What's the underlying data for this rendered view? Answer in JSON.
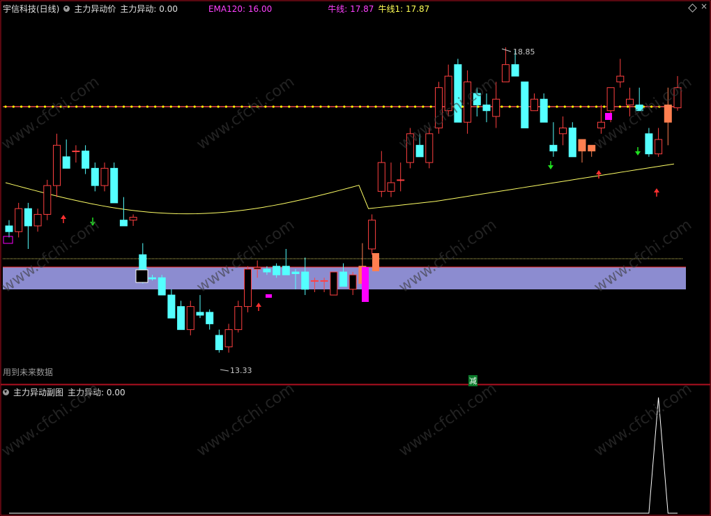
{
  "main_header": {
    "stock": "宇信科技(日线)",
    "indicator": "主力异动价",
    "value_label": "主力异动: 0.00",
    "ema_label": "EMA120: 16.00",
    "niu_label": "牛线: 17.87",
    "niu1_label": "牛线1: 17.87"
  },
  "sub_header": {
    "indicator": "主力异动副图",
    "value_label": "主力异动: 0.00"
  },
  "annotations": {
    "high": "18.85",
    "low": "13.33",
    "future_data": "用到未来数据",
    "jian": "减"
  },
  "watermark": "www.cfchi.com",
  "colors": {
    "up": "#ff4040",
    "down": "#54ffff",
    "ema": "#ffff66",
    "niu": "#ffff00",
    "band": "#8c8cd0",
    "magenta": "#ff00ff",
    "orange": "#ff7f50",
    "border": "#b01020"
  },
  "chart_data": {
    "type": "candlestick",
    "ohlc": [
      [
        15.8,
        15.9,
        15.6,
        15.7
      ],
      [
        15.7,
        16.2,
        15.6,
        16.1
      ],
      [
        16.1,
        16.2,
        15.4,
        15.8
      ],
      [
        15.8,
        16.1,
        15.7,
        16.0
      ],
      [
        16.0,
        16.6,
        15.9,
        16.5
      ],
      [
        16.5,
        17.4,
        16.3,
        17.2
      ],
      [
        17.0,
        17.3,
        16.8,
        16.8
      ],
      [
        17.1,
        17.2,
        16.9,
        17.1
      ],
      [
        17.1,
        17.2,
        16.7,
        16.8
      ],
      [
        16.8,
        16.9,
        16.4,
        16.5
      ],
      [
        16.5,
        16.9,
        16.4,
        16.8
      ],
      [
        16.8,
        16.9,
        16.2,
        16.2
      ],
      [
        15.9,
        16.3,
        15.8,
        15.8
      ],
      [
        15.9,
        16.0,
        15.8,
        15.95
      ],
      [
        15.3,
        15.5,
        14.8,
        14.9
      ],
      [
        14.9,
        14.95,
        14.85,
        14.88
      ],
      [
        14.9,
        14.95,
        14.6,
        14.6
      ],
      [
        14.6,
        14.7,
        14.2,
        14.2
      ],
      [
        14.4,
        14.5,
        14.0,
        14.0
      ],
      [
        14.0,
        14.5,
        13.9,
        14.4
      ],
      [
        14.3,
        14.6,
        14.2,
        14.25
      ],
      [
        14.3,
        14.35,
        14.0,
        14.1
      ],
      [
        13.9,
        14.0,
        13.6,
        13.65
      ],
      [
        13.7,
        14.1,
        13.6,
        14.0
      ],
      [
        14.0,
        14.5,
        13.95,
        14.4
      ],
      [
        14.4,
        15.1,
        14.3,
        15.05
      ],
      [
        15.05,
        15.2,
        14.9,
        15.08
      ],
      [
        15.05,
        15.1,
        14.95,
        15.0
      ],
      [
        15.1,
        15.15,
        14.9,
        14.95
      ],
      [
        15.1,
        15.4,
        14.95,
        14.95
      ],
      [
        15.0,
        15.05,
        14.7,
        14.97
      ],
      [
        15.0,
        15.25,
        14.6,
        14.7
      ],
      [
        14.85,
        14.9,
        14.65,
        14.85
      ],
      [
        14.85,
        14.9,
        14.65,
        14.85
      ],
      [
        14.6,
        15.0,
        14.6,
        15.0
      ],
      [
        15.0,
        15.15,
        14.8,
        14.75
      ],
      [
        14.7,
        15.0,
        14.6,
        14.95
      ],
      [
        15.1,
        15.5,
        14.9,
        14.8
      ],
      [
        15.4,
        16.0,
        15.3,
        15.9
      ],
      [
        16.4,
        17.1,
        16.3,
        16.9
      ],
      [
        16.4,
        16.9,
        16.3,
        16.55
      ],
      [
        16.6,
        16.9,
        16.4,
        16.6
      ],
      [
        16.9,
        17.5,
        16.8,
        17.4
      ],
      [
        17.2,
        17.4,
        17.0,
        17.0
      ],
      [
        16.9,
        17.5,
        16.8,
        17.4
      ],
      [
        17.5,
        18.3,
        17.4,
        18.2
      ],
      [
        17.8,
        18.6,
        17.7,
        18.4
      ],
      [
        18.6,
        18.7,
        17.6,
        17.6
      ],
      [
        17.6,
        18.5,
        17.4,
        18.3
      ],
      [
        18.1,
        18.2,
        17.7,
        17.9
      ],
      [
        17.9,
        18.1,
        17.6,
        17.8
      ],
      [
        17.7,
        18.3,
        17.5,
        18.0
      ],
      [
        18.3,
        18.9,
        18.3,
        18.6
      ],
      [
        18.6,
        18.85,
        18.4,
        18.4
      ],
      [
        18.3,
        18.3,
        17.5,
        17.5
      ],
      [
        17.8,
        18.1,
        17.8,
        18.0
      ],
      [
        18.0,
        18.1,
        17.6,
        17.6
      ],
      [
        17.2,
        17.6,
        17.0,
        17.1
      ],
      [
        17.4,
        17.7,
        17.2,
        17.5
      ],
      [
        17.5,
        17.6,
        17.0,
        17.0
      ],
      [
        17.1,
        17.2,
        16.9,
        17.3
      ],
      [
        17.1,
        17.2,
        17.0,
        17.2
      ],
      [
        17.5,
        17.9,
        17.4,
        17.6
      ],
      [
        17.8,
        18.0,
        17.6,
        18.2
      ],
      [
        18.3,
        18.7,
        18.2,
        18.4
      ],
      [
        17.9,
        18.2,
        17.7,
        18.0
      ],
      [
        17.9,
        18.2,
        17.8,
        17.8
      ],
      [
        17.4,
        17.5,
        17.0,
        17.05
      ],
      [
        17.05,
        17.5,
        17.0,
        17.3
      ],
      [
        17.6,
        18.2,
        17.2,
        17.9
      ],
      [
        17.85,
        18.4,
        17.8,
        18.2
      ]
    ],
    "ema120": 16.0,
    "niu": 17.87,
    "niu1": 17.87,
    "high_label": 18.85,
    "low_label": 13.33,
    "sub_series": [
      0,
      0,
      0,
      0,
      0,
      0,
      0,
      0,
      0,
      0,
      0,
      0,
      0,
      0,
      0,
      0,
      0,
      0,
      0,
      0,
      0,
      0,
      0,
      0,
      0,
      0,
      0,
      0,
      0,
      0,
      0,
      0,
      0,
      0,
      0,
      0,
      0,
      0,
      0,
      0,
      0,
      0,
      0,
      0,
      0,
      0,
      0,
      0,
      0,
      0,
      0,
      0,
      0,
      0,
      0,
      0,
      0,
      0,
      0,
      0,
      0,
      0,
      0,
      0,
      0,
      0,
      0,
      0,
      1,
      0,
      0
    ]
  }
}
